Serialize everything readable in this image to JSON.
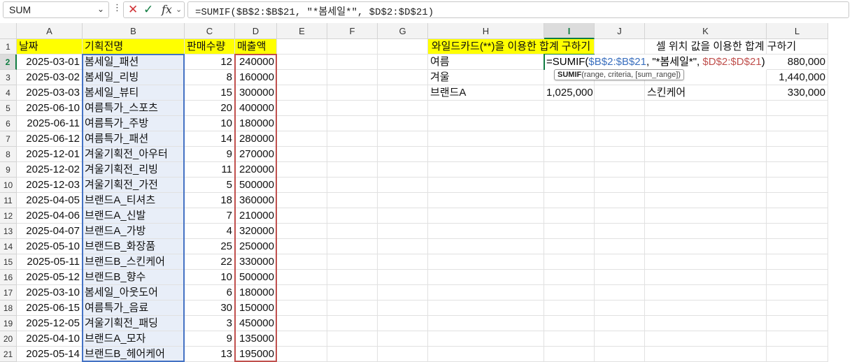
{
  "formula_bar": {
    "name_box": "SUM",
    "dots": "⋮",
    "fx": "fx",
    "formula": "=SUMIF($B$2:$B$21, \"*봄세일*\", $D$2:$D$21)"
  },
  "columns": [
    "A",
    "B",
    "C",
    "D",
    "E",
    "F",
    "G",
    "H",
    "I",
    "J",
    "K",
    "L"
  ],
  "rows": [
    "1",
    "2",
    "3",
    "4",
    "5",
    "6",
    "7",
    "8",
    "9",
    "10",
    "11",
    "12",
    "13",
    "14",
    "15",
    "16",
    "17",
    "18",
    "19",
    "20",
    "21"
  ],
  "headers": {
    "date": "날짜",
    "event": "기획전명",
    "qty": "판매수량",
    "sales": "매출액"
  },
  "table": [
    [
      "2025-03-01",
      "봄세일_패션",
      "12",
      "240000"
    ],
    [
      "2025-03-02",
      "봄세일_리빙",
      "8",
      "160000"
    ],
    [
      "2025-03-03",
      "봄세일_뷰티",
      "15",
      "300000"
    ],
    [
      "2025-06-10",
      "여름특가_스포츠",
      "20",
      "400000"
    ],
    [
      "2025-06-11",
      "여름특가_주방",
      "10",
      "180000"
    ],
    [
      "2025-06-12",
      "여름특가_패션",
      "14",
      "280000"
    ],
    [
      "2025-12-01",
      "겨울기획전_아우터",
      "9",
      "270000"
    ],
    [
      "2025-12-02",
      "겨울기획전_리빙",
      "11",
      "220000"
    ],
    [
      "2025-12-03",
      "겨울기획전_가전",
      "5",
      "500000"
    ],
    [
      "2025-04-05",
      "브랜드A_티셔츠",
      "18",
      "360000"
    ],
    [
      "2025-04-06",
      "브랜드A_신발",
      "7",
      "210000"
    ],
    [
      "2025-04-07",
      "브랜드A_가방",
      "4",
      "320000"
    ],
    [
      "2025-05-10",
      "브랜드B_화장품",
      "25",
      "250000"
    ],
    [
      "2025-05-11",
      "브랜드B_스킨케어",
      "22",
      "330000"
    ],
    [
      "2025-05-12",
      "브랜드B_향수",
      "10",
      "500000"
    ],
    [
      "2025-03-10",
      "봄세일_아웃도어",
      "6",
      "180000"
    ],
    [
      "2025-06-15",
      "여름특가_음료",
      "30",
      "150000"
    ],
    [
      "2025-12-05",
      "겨울기획전_패딩",
      "3",
      "450000"
    ],
    [
      "2025-04-10",
      "브랜드A_모자",
      "9",
      "135000"
    ],
    [
      "2025-05-14",
      "브랜드B_헤어케어",
      "13",
      "195000"
    ]
  ],
  "wildcard": {
    "title": "와일드카드(**)을 이용한 합계 구하기",
    "labels": [
      "여름",
      "겨울",
      "브랜드A"
    ],
    "editing_parts": [
      "=SUMIF(",
      "$B$2:$B$21",
      ", \"*봄세일*\", ",
      "$D$2:$D$21",
      ")"
    ],
    "result_row4": "1,025,000",
    "tooltip_fn": "SUMIF",
    "tooltip_args": "(range, criteria, [sum_range])"
  },
  "cellref": {
    "title": "셀 위치 값을 이용한 합계 구하기",
    "values": [
      "880,000",
      "1,440,000",
      "330,000"
    ],
    "label_row4": "스킨케어"
  },
  "colors": {
    "yellow": "#ffff00",
    "excel_green": "#107c41",
    "ref_blue": "#4472c4",
    "ref_red": "#c0504d"
  }
}
